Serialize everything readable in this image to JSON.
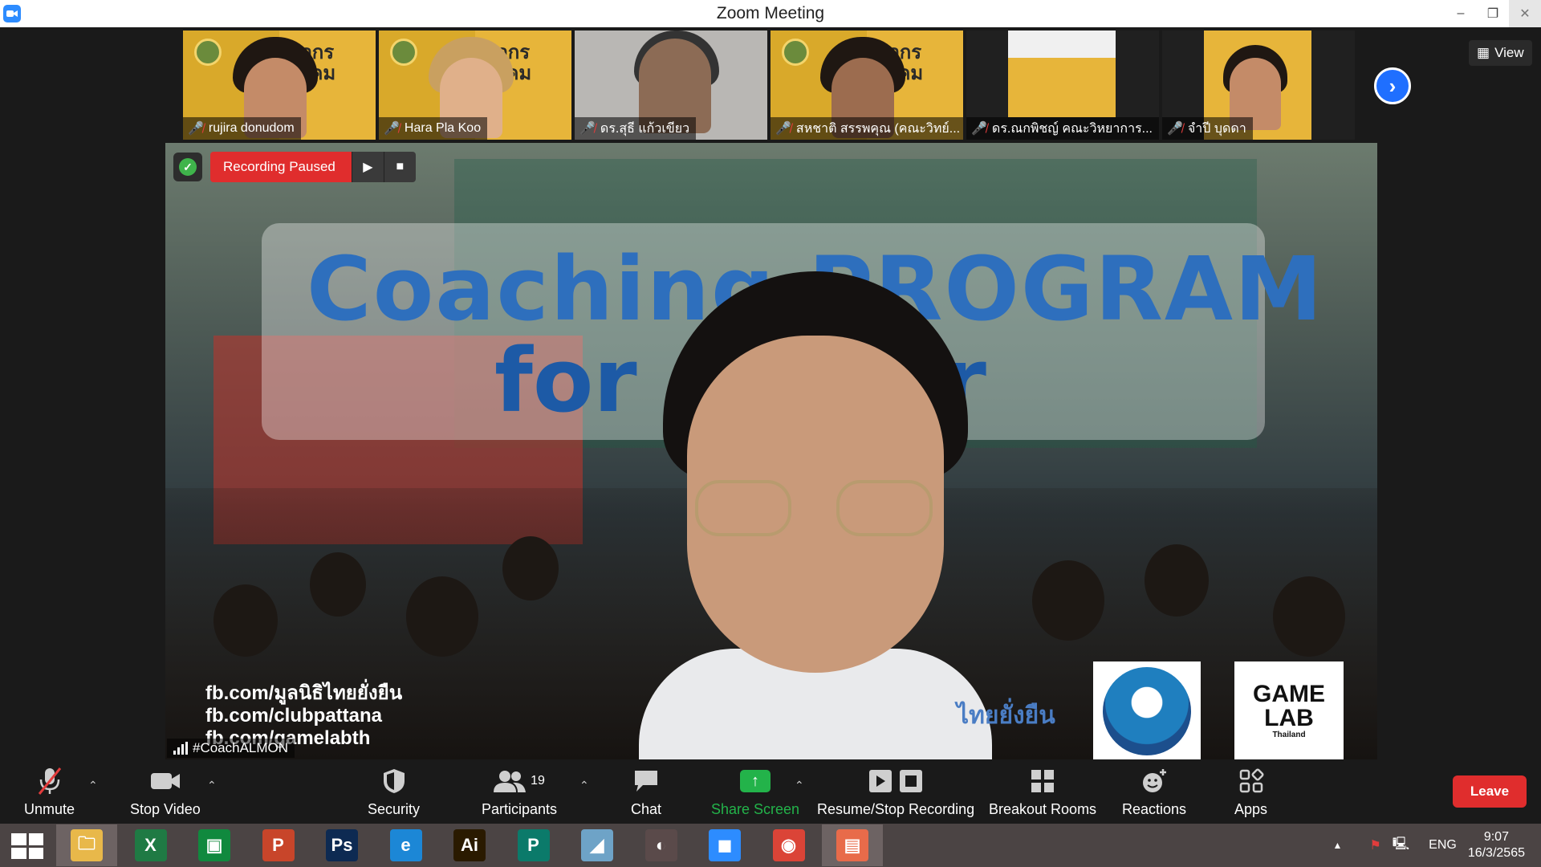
{
  "window": {
    "title": "Zoom Meeting",
    "minimize": "–",
    "restore": "❐",
    "close": "✕"
  },
  "thumbnails": [
    {
      "name": "rujira donudom"
    },
    {
      "name": "Hara Pla Koo"
    },
    {
      "name": "ดร.สุธี แก้วเขียว"
    },
    {
      "name": "สหชาติ สรรพคุณ (คณะวิทย์..."
    },
    {
      "name": "ดร.ณกพิชญ์ คณะวิหยาการ..."
    },
    {
      "name": "จำปี บุดดา"
    }
  ],
  "poster_text": "ศวกร\nสังคม",
  "view_button": "View",
  "recording": {
    "status": "Recording Paused",
    "play": "▶",
    "stop": "■"
  },
  "main_video": {
    "title_line1": "Coaching PROGRAM",
    "title_line2": "for        er",
    "social": [
      "fb.com/มูลนิธิไทยยั่งยืน",
      "fb.com/clubpattana",
      "fb.com/gamelabth"
    ],
    "logo_thai": "ไทยยั่งยืน",
    "logo_game": "GAME",
    "logo_lab": "LAB",
    "logo_sub": "Thailand"
  },
  "speaker_label": "#CoachALMON",
  "toolbar": {
    "unmute": "Unmute",
    "stop_video": "Stop Video",
    "security": "Security",
    "participants": "Participants",
    "participants_count": "19",
    "chat": "Chat",
    "share_screen": "Share Screen",
    "resume_stop_recording": "Resume/Stop Recording",
    "breakout_rooms": "Breakout Rooms",
    "reactions": "Reactions",
    "apps": "Apps",
    "leave": "Leave"
  },
  "taskbar": {
    "apps": [
      {
        "name": "file-explorer",
        "glyph": "🗀",
        "color": "#e8b84a"
      },
      {
        "name": "excel",
        "glyph": "X",
        "color": "#1f7a44"
      },
      {
        "name": "store",
        "glyph": "▣",
        "color": "#10893e"
      },
      {
        "name": "powerpoint",
        "glyph": "P",
        "color": "#c8452a"
      },
      {
        "name": "photoshop",
        "glyph": "Ps",
        "color": "#0d2a52"
      },
      {
        "name": "internet-explorer",
        "glyph": "e",
        "color": "#1c87d6"
      },
      {
        "name": "illustrator",
        "glyph": "Ai",
        "color": "#2a1a00"
      },
      {
        "name": "publisher",
        "glyph": "P",
        "color": "#0b7a6a"
      },
      {
        "name": "notes",
        "glyph": "◢",
        "color": "#6ea3c7"
      },
      {
        "name": "photoscape",
        "glyph": "◐",
        "color": "#5a4a4a"
      },
      {
        "name": "zoom",
        "glyph": "◼",
        "color": "#2d8cff"
      },
      {
        "name": "chrome",
        "glyph": "◉",
        "color": "#db4437"
      },
      {
        "name": "photos",
        "glyph": "▤",
        "color": "#e86b4a"
      }
    ],
    "language": "ENG",
    "time": "9:07",
    "date": "16/3/2565"
  }
}
